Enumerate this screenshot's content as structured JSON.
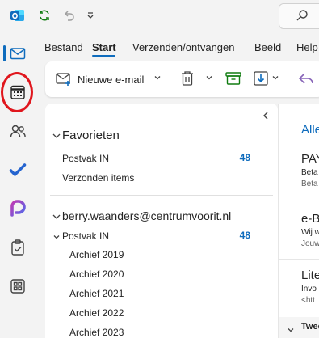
{
  "colors": {
    "accent": "#0f6cbd",
    "annotation": "#e0161d",
    "bg": "#f3f3f3"
  },
  "titlebar": {
    "icons": [
      "outlook-logo-icon",
      "sync-icon",
      "undo-icon",
      "customize-toolbar-icon",
      "search-icon"
    ]
  },
  "rail": {
    "items": [
      {
        "name": "mail-icon",
        "active": true
      },
      {
        "name": "calendar-icon",
        "active": false
      },
      {
        "name": "people-icon",
        "active": false
      },
      {
        "name": "todo-icon",
        "active": false
      },
      {
        "name": "copilot-icon",
        "active": false
      },
      {
        "name": "clipboard-icon",
        "active": false
      },
      {
        "name": "more-apps-icon",
        "active": false
      }
    ]
  },
  "menu": {
    "tabs": [
      "Bestand",
      "Start",
      "Verzenden/ontvangen",
      "Beeld",
      "Help"
    ],
    "active": "Start"
  },
  "ribbon": {
    "new_email_label": "Nieuwe e-mail"
  },
  "folders": {
    "favorites_label": "Favorieten",
    "favorites": [
      {
        "label": "Postvak IN",
        "count": "48"
      },
      {
        "label": "Verzonden items",
        "count": ""
      }
    ],
    "account": "berry.waanders@centrumvoorit.nl",
    "inbox_label": "Postvak IN",
    "inbox_count": "48",
    "subfolders": [
      "Archief 2019",
      "Archief 2020",
      "Archief 2021",
      "Archief 2022",
      "Archief 2023"
    ]
  },
  "messages": {
    "filter_tab": "Alle",
    "items": [
      {
        "sender": "PAY",
        "subject": "Beta",
        "preview": "Beta"
      },
      {
        "sender": "e-B",
        "subject": "Wij w",
        "preview": "Jouw"
      },
      {
        "sender": "Lite",
        "subject": "Invo",
        "preview": "<htt"
      }
    ],
    "group_header": "Twee"
  }
}
